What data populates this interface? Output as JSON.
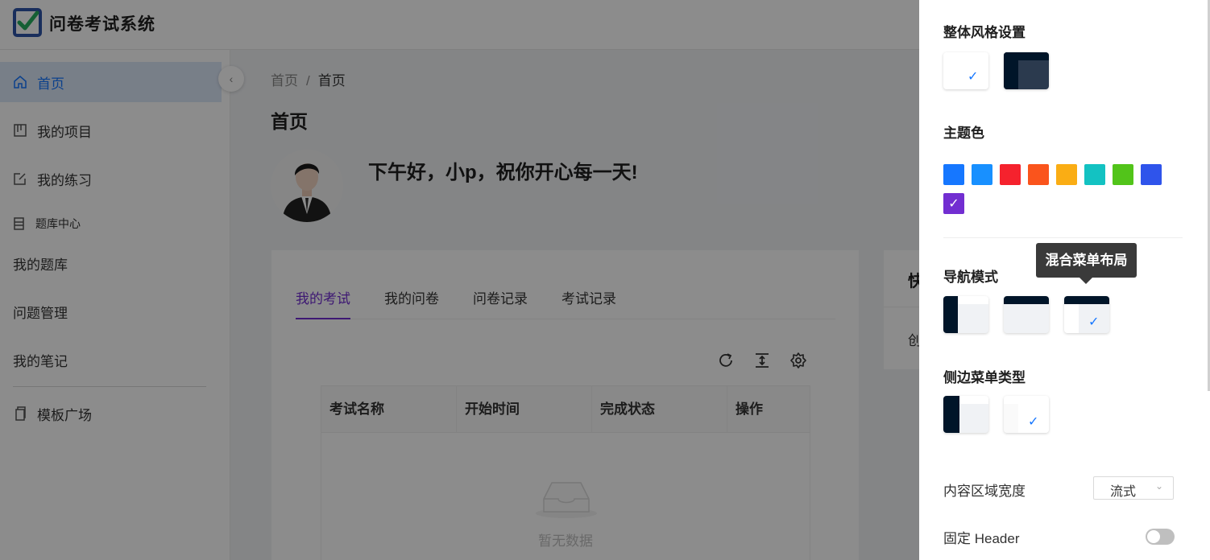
{
  "app": {
    "title": "问卷考试系统"
  },
  "sidebar": {
    "items": [
      {
        "label": "首页",
        "icon": "home-icon"
      },
      {
        "label": "我的项目",
        "icon": "project-icon"
      },
      {
        "label": "我的练习",
        "icon": "edit-icon"
      }
    ],
    "group_label": "题库中心",
    "group_items": [
      "我的题库",
      "问题管理",
      "我的笔记"
    ],
    "template_label": "模板广场"
  },
  "breadcrumb": {
    "home": "首页",
    "separator": "/",
    "current": "首页"
  },
  "page_title": "首页",
  "greeting": "下午好，小p，祝你开心每一天!",
  "tabs": [
    "我的考试",
    "我的问卷",
    "问卷记录",
    "考试记录"
  ],
  "table": {
    "columns": [
      "考试名称",
      "开始时间",
      "完成状态",
      "操作"
    ],
    "empty_text": "暂无数据"
  },
  "side_card": {
    "title": "快",
    "text": "创"
  },
  "drawer": {
    "style_title": "整体风格设置",
    "theme_title": "主题色",
    "theme_colors": [
      "#1677ff",
      "#1890ff",
      "#f5222d",
      "#fa541c",
      "#faad14",
      "#13c2c2",
      "#52c41a",
      "#2f54eb",
      "#722ed1"
    ],
    "selected_color": "#722ed1",
    "nav_title": "导航模式",
    "tooltip": "混合菜单布局",
    "side_menu_title": "侧边菜单类型",
    "content_width_label": "内容区域宽度",
    "content_width_value": "流式",
    "fixed_header_label": "固定 Header",
    "fixed_header_on": false
  }
}
